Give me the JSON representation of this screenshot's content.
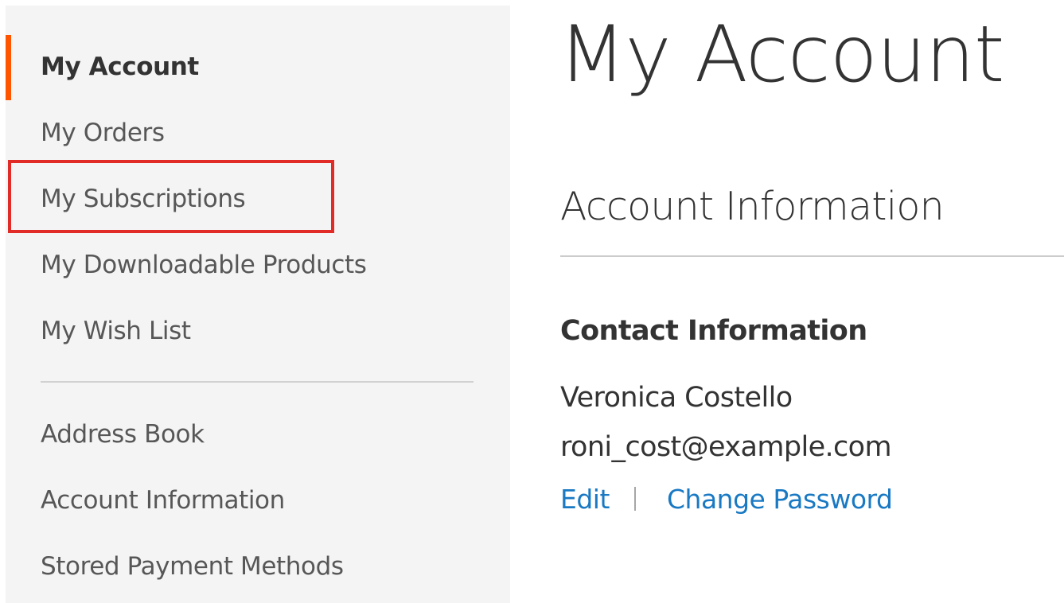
{
  "sidebar": {
    "items": [
      {
        "label": "My Account",
        "active": true
      },
      {
        "label": "My Orders"
      },
      {
        "label": "My Subscriptions",
        "highlighted": true
      },
      {
        "label": "My Downloadable Products"
      },
      {
        "label": "My Wish List"
      },
      {
        "label": "Address Book"
      },
      {
        "label": "Account Information"
      },
      {
        "label": "Stored Payment Methods"
      }
    ]
  },
  "main": {
    "page_title": "My Account",
    "block_title": "Account Information",
    "contact": {
      "title": "Contact Information",
      "name": "Veronica Costello",
      "email": "roni_cost@example.com",
      "edit_label": "Edit",
      "change_password_label": "Change Password"
    }
  },
  "colors": {
    "accent": "#ff5501",
    "highlight": "#e02b27",
    "link": "#1979c3",
    "sidebar_bg": "#f4f4f4",
    "text": "#333333"
  }
}
